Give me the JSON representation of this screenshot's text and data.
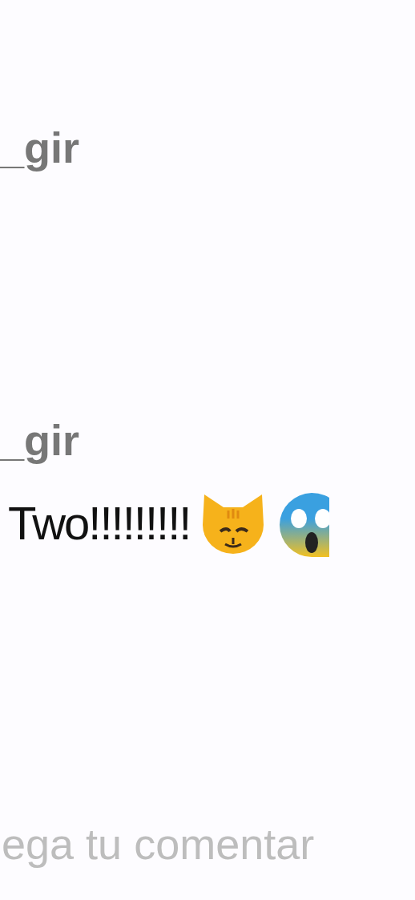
{
  "comments": [
    {
      "username": "_gir"
    },
    {
      "username": "_gir",
      "text": "Two!!!!!!!!!"
    }
  ],
  "comment_field": {
    "placeholder": "ega tu comentar"
  }
}
